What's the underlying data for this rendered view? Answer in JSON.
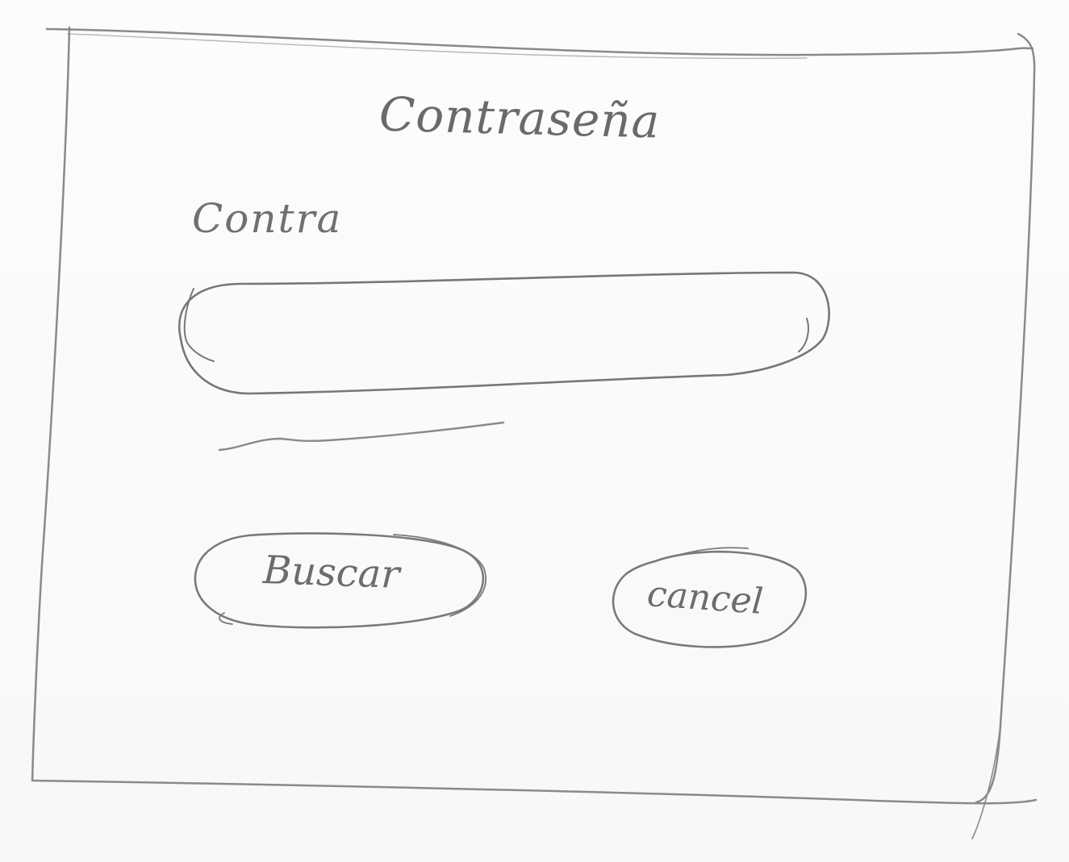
{
  "dialog": {
    "title": "Contraseña",
    "field_label": "Contra",
    "password_value": "",
    "buttons": {
      "search_label": "Buscar",
      "cancel_label": "cancel"
    }
  },
  "colors": {
    "paper": "#fbfbfa",
    "pencil": "#7a7a7a"
  }
}
